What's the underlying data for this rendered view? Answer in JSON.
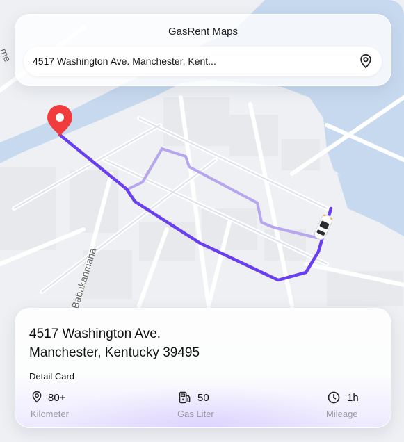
{
  "header": {
    "app_title": "GasRent Maps",
    "search_value": "4517 Washington Ave. Manchester, Kent..."
  },
  "map": {
    "street_label": "Babakanmana",
    "edge_label": "me",
    "route_color": "#6a3ff0",
    "alt_route_color": "#b7a6ee",
    "water_color": "#c5d8ef",
    "pin_color": "#f03c3c"
  },
  "detail": {
    "address_line1": "4517 Washington Ave.",
    "address_line2": "Manchester, Kentucky 39495",
    "card_title": "Detail Card",
    "stats": [
      {
        "value": "80+",
        "label": "Kilometer",
        "icon": "location-pin-icon"
      },
      {
        "value": "50",
        "label": "Gas Liter",
        "icon": "gas-station-icon"
      },
      {
        "value": "1h",
        "label": "Mileage",
        "icon": "clock-icon"
      }
    ]
  }
}
